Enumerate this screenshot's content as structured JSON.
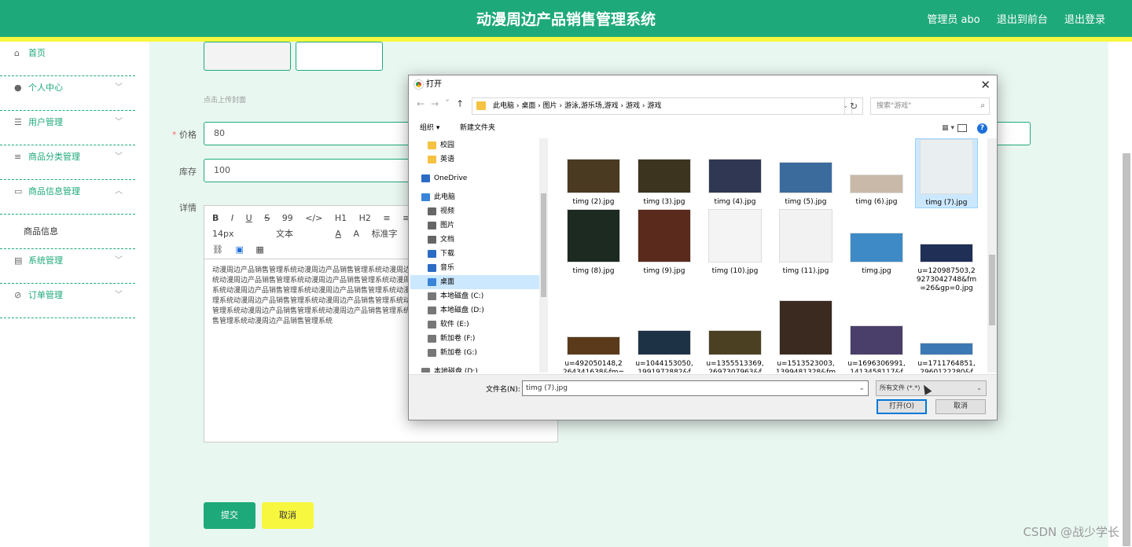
{
  "header": {
    "title": "动漫周边产品销售管理系统",
    "admin": "管理员 abo",
    "to_front": "退出到前台",
    "logout": "退出登录"
  },
  "sidebar": {
    "items": [
      {
        "label": "首页",
        "icon": "home-icon"
      },
      {
        "label": "个人中心",
        "icon": "user-icon"
      },
      {
        "label": "用户管理",
        "icon": "sliders-icon"
      },
      {
        "label": "商品分类管理",
        "icon": "list-icon"
      },
      {
        "label": "商品信息管理",
        "icon": "chat-icon"
      },
      {
        "label": "系统管理",
        "icon": "clipboard-icon"
      },
      {
        "label": "订单管理",
        "icon": "compass-icon"
      }
    ],
    "sub_item": "商品信息"
  },
  "form": {
    "upload_hint": "点击上传封面",
    "price_label": "价格",
    "price_value": "80",
    "stock_label": "库存",
    "stock_value": "100",
    "detail_label": "详情",
    "toolbar_row1": [
      "B",
      "I",
      "U",
      "S",
      "99",
      "</>",
      "H1",
      "H2",
      "≡",
      "≡"
    ],
    "toolbar_row2": [
      "14px",
      "文本",
      "A",
      "A",
      "标准字"
    ],
    "toolbar_row3": [
      "link",
      "image",
      "video"
    ],
    "editor_text": "动漫周边产品销售管理系统动漫周边产品销售管理系统动漫周边产品销售管理系统动漫周边产品销售管理系统动漫周边产品销售管理系统动漫周边产品销售管理系统动漫周边产品销售管理系统动漫周边产品销售管理系统动漫周边产品销售管理系统动漫周边产品销售管理系统动漫周边产品销售管理系统动漫周边产品销售管理系统动漫周边产品销售管理系统动漫周边产品销售管理系统动漫周边产品销售管理系统动漫周边产品销售管理系统动漫周边产品销售管理系统动漫周边产品销售管理系统动漫周边产品销售管理系统动漫周边产品销售管理系统动漫周边产品销售管理系统",
    "submit": "提交",
    "cancel": "取消"
  },
  "dialog": {
    "title": "打开",
    "path": "此电脑  ›  桌面  ›  图片  ›  游泳,游乐场,游戏  ›  游戏  ›  游戏",
    "search_placeholder": "搜索\"游戏\"",
    "organize": "组织 ▾",
    "new_folder": "新建文件夹",
    "tree": [
      {
        "label": "校园",
        "color": "#f5c242"
      },
      {
        "label": "英语",
        "color": "#f5c242"
      },
      {
        "label": "OneDrive",
        "color": "#2b6cc4"
      },
      {
        "label": "此电脑",
        "color": "#3a84d9"
      },
      {
        "label": "视频",
        "color": "#666"
      },
      {
        "label": "图片",
        "color": "#666"
      },
      {
        "label": "文档",
        "color": "#666"
      },
      {
        "label": "下载",
        "color": "#2b6cc4"
      },
      {
        "label": "音乐",
        "color": "#2b6cc4"
      },
      {
        "label": "桌面",
        "color": "#3a84d9"
      },
      {
        "label": "本地磁盘 (C:)",
        "color": "#777"
      },
      {
        "label": "本地磁盘 (D:)",
        "color": "#777"
      },
      {
        "label": "软件 (E:)",
        "color": "#777"
      },
      {
        "label": "新加卷 (F:)",
        "color": "#777"
      },
      {
        "label": "新加卷 (G:)",
        "color": "#777"
      },
      {
        "label": "本地磁盘 (D:)",
        "color": "#777"
      }
    ],
    "files": [
      {
        "name": "timg (2).jpg",
        "bg": "#4a3a22"
      },
      {
        "name": "timg (3).jpg",
        "bg": "#3d3420"
      },
      {
        "name": "timg (4).jpg",
        "bg": "#2f3752"
      },
      {
        "name": "timg (5).jpg",
        "bg": "#3b6a9c"
      },
      {
        "name": "timg (6).jpg",
        "bg": "#c9b9a8"
      },
      {
        "name": "timg (7).jpg",
        "bg": "#e9eef0"
      },
      {
        "name": "timg (8).jpg",
        "bg": "#1c2a22"
      },
      {
        "name": "timg (9).jpg",
        "bg": "#5a2a1c"
      },
      {
        "name": "timg (10).jpg",
        "bg": "#f4f4f4"
      },
      {
        "name": "timg (11).jpg",
        "bg": "#f2f2f2"
      },
      {
        "name": "timg.jpg",
        "bg": "#3d8ac6"
      },
      {
        "name": "u=120987503,2 9273042748&fm =26&gp=0.jpg",
        "bg": "#1f2f55"
      },
      {
        "name": "u=492050148,2 264341638&fm=",
        "bg": "#5a3a1a"
      },
      {
        "name": "u=1044153050, 1991972882&f",
        "bg": "#1e3246"
      },
      {
        "name": "u=1355513369, 2697307963&f",
        "bg": "#4b4022"
      },
      {
        "name": "u=1513523003, 1399481328&fm",
        "bg": "#3a2a20"
      },
      {
        "name": "u=1696306991, 1413458117&f",
        "bg": "#4a3f6a"
      },
      {
        "name": "u=1711764851, 2960122280&f",
        "bg": "#3c78b4"
      }
    ],
    "filename_label": "文件名(N):",
    "filename_value": "timg (7).jpg",
    "filetype": "所有文件 (*.*)",
    "open": "打开(O)",
    "cancel": "取消"
  },
  "watermark": "CSDN @战少学长"
}
